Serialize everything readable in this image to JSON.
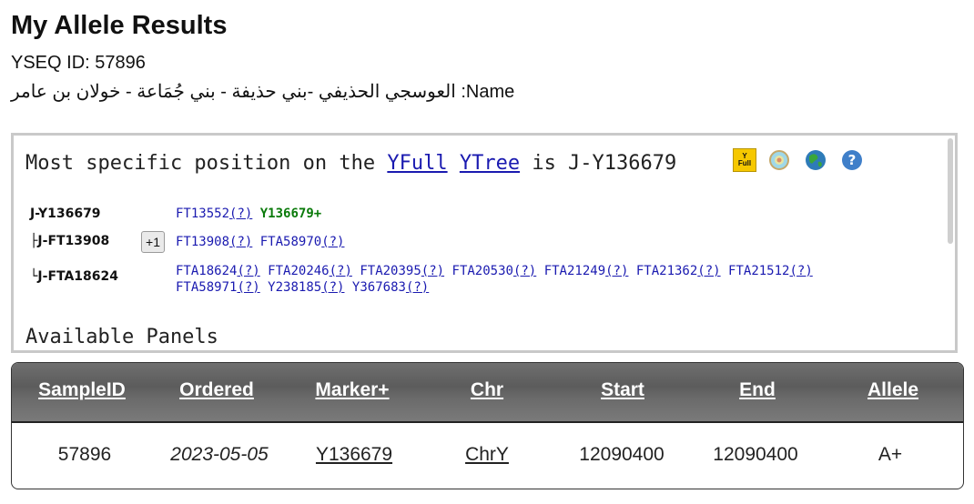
{
  "header": {
    "title": "My Allele Results",
    "yseq_line": "YSEQ ID: 57896",
    "name_line": "العوسجي الحذيفي -بني حذيفة - بني جُمَاعة - خولان بن عامر :Name"
  },
  "tree": {
    "most_prefix": "Most specific position on the ",
    "link_yfull": "YFull",
    "link_ytree": "YTree",
    "most_suffix": " is J-Y136679",
    "yfull_icon_top": "Y",
    "yfull_icon_bottom": "Full",
    "icons": [
      "yfull-logo-icon",
      "ytree-globe-icon",
      "globe-map-icon",
      "help-icon"
    ],
    "rows": [
      {
        "node": "J-Y136679",
        "snps_text": "FT13552",
        "q": "(?)",
        "positive": "Y136679+"
      },
      {
        "node": "├J-FT13908",
        "plus": "+1"
      },
      {
        "node": "└J-FTA18624"
      }
    ],
    "row2_snps": [
      {
        "name": "FT13908",
        "q": "(?)"
      },
      {
        "name": "FTA58970",
        "q": "(?)"
      }
    ],
    "row3_snps": [
      {
        "name": "FTA18624",
        "q": "(?)"
      },
      {
        "name": "FTA20246",
        "q": "(?)"
      },
      {
        "name": "FTA20395",
        "q": "(?)"
      },
      {
        "name": "FTA20530",
        "q": "(?)"
      },
      {
        "name": "FTA21249",
        "q": "(?)"
      },
      {
        "name": "FTA21362",
        "q": "(?)"
      },
      {
        "name": "FTA21512",
        "q": "(?)"
      },
      {
        "name": "FTA58971",
        "q": "(?)"
      },
      {
        "name": "Y238185",
        "q": "(?)"
      },
      {
        "name": "Y367683",
        "q": "(?)"
      }
    ],
    "available_panels": "Available Panels"
  },
  "table": {
    "headers": [
      "SampleID",
      "Ordered",
      "Marker+",
      "Chr",
      "Start",
      "End",
      "Allele"
    ],
    "row": {
      "sample_id": "57896",
      "ordered": "2023-05-05",
      "marker": "Y136679",
      "chr": "ChrY",
      "start": "12090400",
      "end": "12090400",
      "allele": "A+"
    }
  }
}
